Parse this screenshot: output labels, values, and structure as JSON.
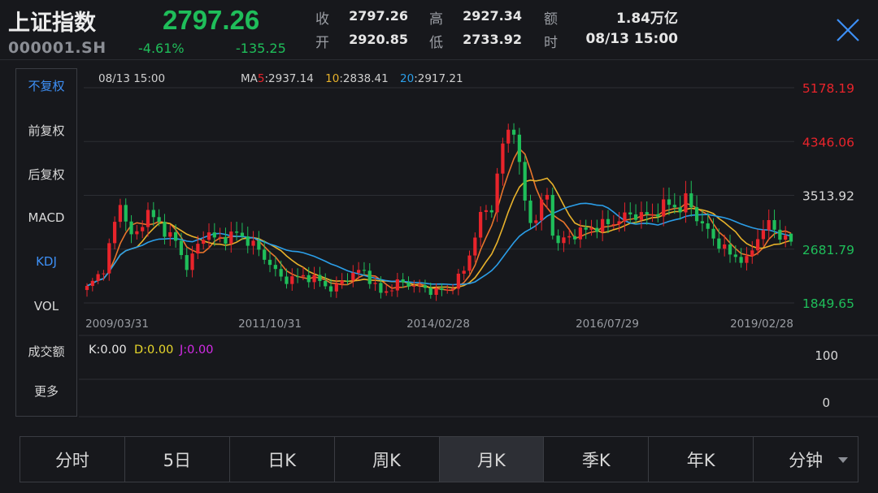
{
  "header": {
    "name": "上证指数",
    "code": "000001.SH",
    "price": "2797.26",
    "change_pct": "-4.61%",
    "change_abs": "-135.25",
    "quote": {
      "close_label": "收",
      "close": "2797.26",
      "high_label": "高",
      "high": "2927.34",
      "amount_label": "额",
      "amount": "1.84万亿",
      "open_label": "开",
      "open": "2920.85",
      "low_label": "低",
      "low": "2733.92",
      "time_label": "时",
      "time": "08/13 15:00"
    }
  },
  "menu": {
    "items": [
      {
        "label": "不复权",
        "active": true
      },
      {
        "label": "前复权",
        "active": false
      },
      {
        "label": "后复权",
        "active": false
      },
      {
        "label": "MACD",
        "active": false
      },
      {
        "label": "KDJ",
        "active": true
      },
      {
        "label": "VOL",
        "active": false
      },
      {
        "label": "成交额",
        "active": false
      },
      {
        "label": "更多",
        "active": false
      }
    ]
  },
  "chart": {
    "time": "08/13 15:00",
    "ma5_prefix": "MA",
    "ma5_num": "5",
    "ma5_val": ":2937.14",
    "ma10_num": "10",
    "ma10_val": ":2838.41",
    "ma20_num": "20",
    "ma20_val": ":2917.21",
    "yticks": [
      "5178.19",
      "4346.06",
      "3513.92",
      "2681.79",
      "1849.65"
    ],
    "xticks": [
      "2009/03/31",
      "2011/10/31",
      "2014/02/28",
      "2016/07/29",
      "2019/02/28"
    ],
    "kdj": {
      "k": "K:0.00",
      "d": "D:0.00",
      "j": "J:0.00",
      "top": "100",
      "bottom": "0"
    },
    "colors": {
      "up": "#e8242b",
      "down": "#1fbe5a",
      "ma5": "#e8742b",
      "ma10": "#e8b22b",
      "ma20": "#2b9ee8",
      "k": "#e6e6e6",
      "d": "#e8d82b",
      "j": "#d42be8"
    }
  },
  "chart_data": {
    "type": "candlestick",
    "ylim": [
      1849.65,
      5178.19
    ],
    "x_start": "2009-01",
    "x_end": "2019-08",
    "close_series": [
      [
        2009.0,
        2082
      ],
      [
        2009.25,
        2373
      ],
      [
        2009.5,
        3412
      ],
      [
        2009.7,
        2780
      ],
      [
        2009.9,
        3277
      ],
      [
        2010.1,
        3051
      ],
      [
        2010.35,
        2781
      ],
      [
        2010.5,
        2398
      ],
      [
        2010.8,
        2978
      ],
      [
        2010.95,
        2808
      ],
      [
        2011.25,
        2928
      ],
      [
        2011.5,
        2762
      ],
      [
        2011.75,
        2468
      ],
      [
        2011.95,
        2199
      ],
      [
        2012.25,
        2262
      ],
      [
        2012.45,
        2225
      ],
      [
        2012.7,
        2047
      ],
      [
        2012.95,
        2269
      ],
      [
        2013.15,
        2365
      ],
      [
        2013.45,
        1979
      ],
      [
        2013.7,
        2174
      ],
      [
        2013.95,
        2116
      ],
      [
        2014.2,
        2033
      ],
      [
        2014.45,
        2048
      ],
      [
        2014.7,
        2363
      ],
      [
        2014.95,
        3234
      ],
      [
        2015.1,
        3310
      ],
      [
        2015.3,
        4441
      ],
      [
        2015.45,
        4611
      ],
      [
        2015.55,
        3663
      ],
      [
        2015.7,
        3052
      ],
      [
        2015.95,
        3539
      ],
      [
        2016.05,
        2737
      ],
      [
        2016.35,
        2917
      ],
      [
        2016.6,
        3004
      ],
      [
        2016.95,
        3103
      ],
      [
        2017.2,
        3222
      ],
      [
        2017.5,
        3192
      ],
      [
        2017.75,
        3393
      ],
      [
        2017.95,
        3307
      ],
      [
        2018.05,
        3480
      ],
      [
        2018.2,
        3168
      ],
      [
        2018.45,
        2847
      ],
      [
        2018.7,
        2602
      ],
      [
        2018.95,
        2493
      ],
      [
        2019.15,
        2940
      ],
      [
        2019.3,
        3078
      ],
      [
        2019.45,
        2898
      ],
      [
        2019.6,
        2797
      ]
    ],
    "last": {
      "open": 2920.85,
      "high": 2927.34,
      "low": 2733.92,
      "close": 2797.26
    },
    "ma": {
      "MA5": 2937.14,
      "MA10": 2838.41,
      "MA20": 2917.21
    }
  },
  "tabs": [
    {
      "label": "分时",
      "active": false
    },
    {
      "label": "5日",
      "active": false
    },
    {
      "label": "日K",
      "active": false
    },
    {
      "label": "周K",
      "active": false
    },
    {
      "label": "月K",
      "active": true
    },
    {
      "label": "季K",
      "active": false
    },
    {
      "label": "年K",
      "active": false
    },
    {
      "label": "分钟",
      "active": false,
      "dropdown": true
    }
  ]
}
